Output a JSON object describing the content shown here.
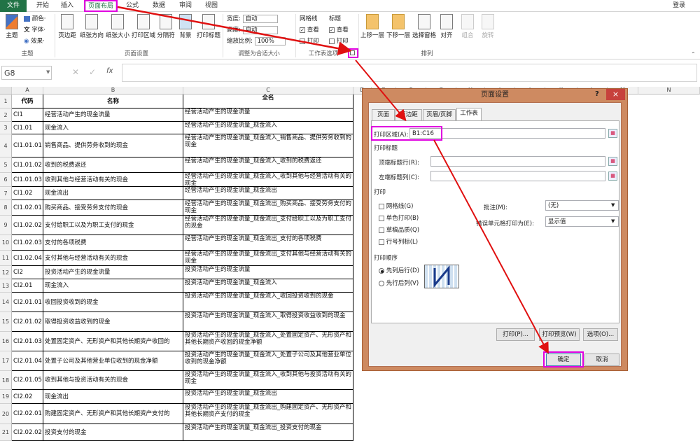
{
  "app": {
    "login": "登录"
  },
  "tabs": [
    "文件",
    "开始",
    "插入",
    "页面布局",
    "公式",
    "数据",
    "审阅",
    "视图"
  ],
  "ribbon": {
    "theme_group": {
      "label": "主题",
      "big": "主题",
      "colors": "颜色·",
      "fonts": "字体·",
      "effects": "效果·"
    },
    "page_setup_group": {
      "label": "页面设置",
      "buttons": [
        "页边距",
        "纸张方向",
        "纸张大小",
        "打印区域",
        "分隔符",
        "背景",
        "打印标题"
      ]
    },
    "scale_group": {
      "label": "调整为合适大小",
      "width_label": "宽度:",
      "width_value": "自动",
      "height_label": "高度:",
      "height_value": "自动",
      "scale_label": "缩放比例:",
      "scale_value": "100%"
    },
    "sheet_options_group": {
      "label": "工作表选项",
      "gridlines": "网格线",
      "headings": "标题",
      "view": "查看",
      "print": "打印"
    },
    "arrange_group": {
      "label": "排列",
      "buttons": [
        "上移一层",
        "下移一层",
        "选择窗格",
        "对齐",
        "组合",
        "旋转"
      ]
    }
  },
  "formula_bar": {
    "name_box": "G8",
    "fx": "fx",
    "value": ""
  },
  "columns": [
    "A",
    "B",
    "C",
    "D",
    "E",
    "F",
    "G",
    "H",
    "I",
    "J",
    "K",
    "L",
    "M",
    "N"
  ],
  "rows": [
    {
      "n": "1",
      "a": "代码",
      "b": "名称",
      "c": "全名"
    },
    {
      "n": "2",
      "a": "CI1",
      "b": "经营活动产生的现金流量",
      "c": "经营活动产生的现金流量"
    },
    {
      "n": "3",
      "a": "CI1.01",
      "b": "现金流入",
      "c": "经营活动产生的现金流量_现金流入"
    },
    {
      "n": "4",
      "a": "CI1.01.01",
      "b": "销售商品、提供劳务收到的现金",
      "c": "经营活动产生的现金流量_现金流入_销售商品、提供劳务收到的现金"
    },
    {
      "n": "5",
      "a": "CI1.01.02",
      "b": "收到的税费返还",
      "c": "经营活动产生的现金流量_现金流入_收到的税费返还"
    },
    {
      "n": "6",
      "a": "CI1.01.03",
      "b": "收到其他与经营活动有关的现金",
      "c": "经营活动产生的现金流量_现金流入_收到其他与经营活动有关的现金"
    },
    {
      "n": "7",
      "a": "CI1.02",
      "b": "现金流出",
      "c": "经营活动产生的现金流量_现金流出"
    },
    {
      "n": "8",
      "a": "CI1.02.01",
      "b": "购买商品、接受劳务支付的现金",
      "c": "经营活动产生的现金流量_现金流出_购买商品、接受劳务支付的现金"
    },
    {
      "n": "9",
      "a": "CI1.02.02",
      "b": "支付给职工以及为职工支付的现金",
      "c": "经营活动产生的现金流量_现金流出_支付给职工以及为职工支付的现金"
    },
    {
      "n": "10",
      "a": "CI1.02.03",
      "b": "支付的各项税费",
      "c": "经营活动产生的现金流量_现金流出_支付的各项税费"
    },
    {
      "n": "11",
      "a": "CI1.02.04",
      "b": "支付其他与经营活动有关的现金",
      "c": "经营活动产生的现金流量_现金流出_支付其他与经营活动有关的现金"
    },
    {
      "n": "12",
      "a": "CI2",
      "b": "投资活动产生的现金流量",
      "c": "投资活动产生的现金流量"
    },
    {
      "n": "13",
      "a": "CI2.01",
      "b": "现金流入",
      "c": "投资活动产生的现金流量_现金流入"
    },
    {
      "n": "14",
      "a": "CI2.01.01",
      "b": "收回投资收到的现金",
      "c": "投资活动产生的现金流量_现金流入_收回投资收到的现金"
    },
    {
      "n": "15",
      "a": "CI2.01.02",
      "b": "取得投资收益收到的现金",
      "c": "投资活动产生的现金流量_现金流入_取得投资收益收到的现金"
    },
    {
      "n": "16",
      "a": "CI2.01.03",
      "b": "处置固定资产、无形资产和其他长期资产收回的",
      "c": "投资活动产生的现金流量_现金流入_处置固定资产、无形资产和其他长期资产收回的现金净额"
    },
    {
      "n": "17",
      "a": "CI2.01.04",
      "b": "处置子公司及其他营业单位收到的现金净额",
      "c": "投资活动产生的现金流量_现金流入_处置子公司及其他营业单位收到的现金净额"
    },
    {
      "n": "18",
      "a": "CI2.01.05",
      "b": "收到其他与投资活动有关的现金",
      "c": "投资活动产生的现金流量_现金流入_收到其他与投资活动有关的现金"
    },
    {
      "n": "19",
      "a": "CI2.02",
      "b": "现金流出",
      "c": "投资活动产生的现金流量_现金流出"
    },
    {
      "n": "20",
      "a": "CI2.02.01",
      "b": "购建固定资产、无形资产和其他长期资产支付的",
      "c": "投资活动产生的现金流量_现金流出_购建固定资产、无形资产和其他长期资产支付的现金"
    },
    {
      "n": "21",
      "a": "CI2.02.02",
      "b": "投资支付的现金",
      "c": "投资活动产生的现金流量_现金流出_投资支付的现金"
    }
  ],
  "dialog": {
    "title": "页面设置",
    "help": "?",
    "close": "×",
    "tabs": [
      "页面",
      "页边距",
      "页眉/页脚",
      "工作表"
    ],
    "print_area_label": "打印区域(A):",
    "print_area_value": "B1:C16",
    "print_titles_label": "打印标题",
    "top_rows_label": "顶端标题行(R):",
    "left_cols_label": "左端标题列(C):",
    "print_label": "打印",
    "gridlines": "网格线(G)",
    "bw": "单色打印(B)",
    "draft": "草稿品质(Q)",
    "rowcol": "行号列标(L)",
    "comments_label": "批注(M):",
    "comments_value": "(无)",
    "errors_label": "错误单元格打印为(E):",
    "errors_value": "显示值",
    "order_label": "打印顺序",
    "down_then_over": "先列后行(D)",
    "over_then_down": "先行后列(V)",
    "print_btn": "打印(P)...",
    "preview_btn": "打印预览(W)",
    "options_btn": "选项(O)...",
    "ok": "确定",
    "cancel": "取消"
  }
}
